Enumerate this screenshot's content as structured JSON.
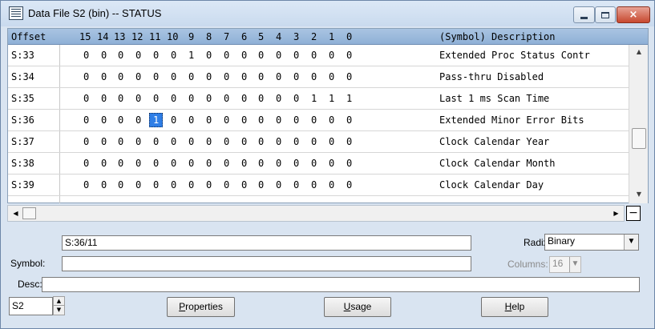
{
  "window": {
    "title": "Data File S2 (bin)  --  STATUS",
    "close_glyph": "×"
  },
  "grid": {
    "header": {
      "offset": "Offset",
      "bits": [
        "15",
        "14",
        "13",
        "12",
        "11",
        "10",
        "9",
        "8",
        "7",
        "6",
        "5",
        "4",
        "3",
        "2",
        "1",
        "0"
      ],
      "description": "(Symbol)  Description"
    },
    "rows": [
      {
        "offset": "S:33",
        "bits": [
          "0",
          "0",
          "0",
          "0",
          "0",
          "0",
          "1",
          "0",
          "0",
          "0",
          "0",
          "0",
          "0",
          "0",
          "0",
          "0"
        ],
        "description": "Extended Proc Status Contr"
      },
      {
        "offset": "S:34",
        "bits": [
          "0",
          "0",
          "0",
          "0",
          "0",
          "0",
          "0",
          "0",
          "0",
          "0",
          "0",
          "0",
          "0",
          "0",
          "0",
          "0"
        ],
        "description": "Pass-thru Disabled"
      },
      {
        "offset": "S:35",
        "bits": [
          "0",
          "0",
          "0",
          "0",
          "0",
          "0",
          "0",
          "0",
          "0",
          "0",
          "0",
          "0",
          "0",
          "1",
          "1",
          "1"
        ],
        "description": "Last 1 ms Scan Time"
      },
      {
        "offset": "S:36",
        "bits": [
          "0",
          "0",
          "0",
          "0",
          "1",
          "0",
          "0",
          "0",
          "0",
          "0",
          "0",
          "0",
          "0",
          "0",
          "0",
          "0"
        ],
        "description": "Extended Minor Error Bits"
      },
      {
        "offset": "S:37",
        "bits": [
          "0",
          "0",
          "0",
          "0",
          "0",
          "0",
          "0",
          "0",
          "0",
          "0",
          "0",
          "0",
          "0",
          "0",
          "0",
          "0"
        ],
        "description": "Clock Calendar Year"
      },
      {
        "offset": "S:38",
        "bits": [
          "0",
          "0",
          "0",
          "0",
          "0",
          "0",
          "0",
          "0",
          "0",
          "0",
          "0",
          "0",
          "0",
          "0",
          "0",
          "0"
        ],
        "description": "Clock Calendar Month"
      },
      {
        "offset": "S:39",
        "bits": [
          "0",
          "0",
          "0",
          "0",
          "0",
          "0",
          "0",
          "0",
          "0",
          "0",
          "0",
          "0",
          "0",
          "0",
          "0",
          "0"
        ],
        "description": "Clock Calendar Day"
      }
    ],
    "selected": {
      "row": 3,
      "bit_index": 4
    }
  },
  "icons": {
    "scroll_up": "▲",
    "scroll_down": "▼",
    "scroll_left": "◀",
    "scroll_right": "▶",
    "dropdown": "▼",
    "collapse": "−"
  },
  "address": {
    "value": "S:36/11"
  },
  "radix": {
    "label": "Radix:",
    "value": "Binary"
  },
  "symbol": {
    "label": "Symbol:",
    "value": ""
  },
  "columns": {
    "label": "Columns:",
    "value": "16"
  },
  "desc": {
    "label": "Desc:",
    "value": ""
  },
  "file_selector": {
    "value": "S2"
  },
  "buttons": {
    "properties_first": "P",
    "properties_rest": "roperties",
    "usage_first": "U",
    "usage_rest": "sage",
    "help_first": "H",
    "help_rest": "elp"
  },
  "colors": {
    "header_bg": "#a9c4e2",
    "selection": "#2f7ee6",
    "window_bg": "#d9e4f1"
  }
}
